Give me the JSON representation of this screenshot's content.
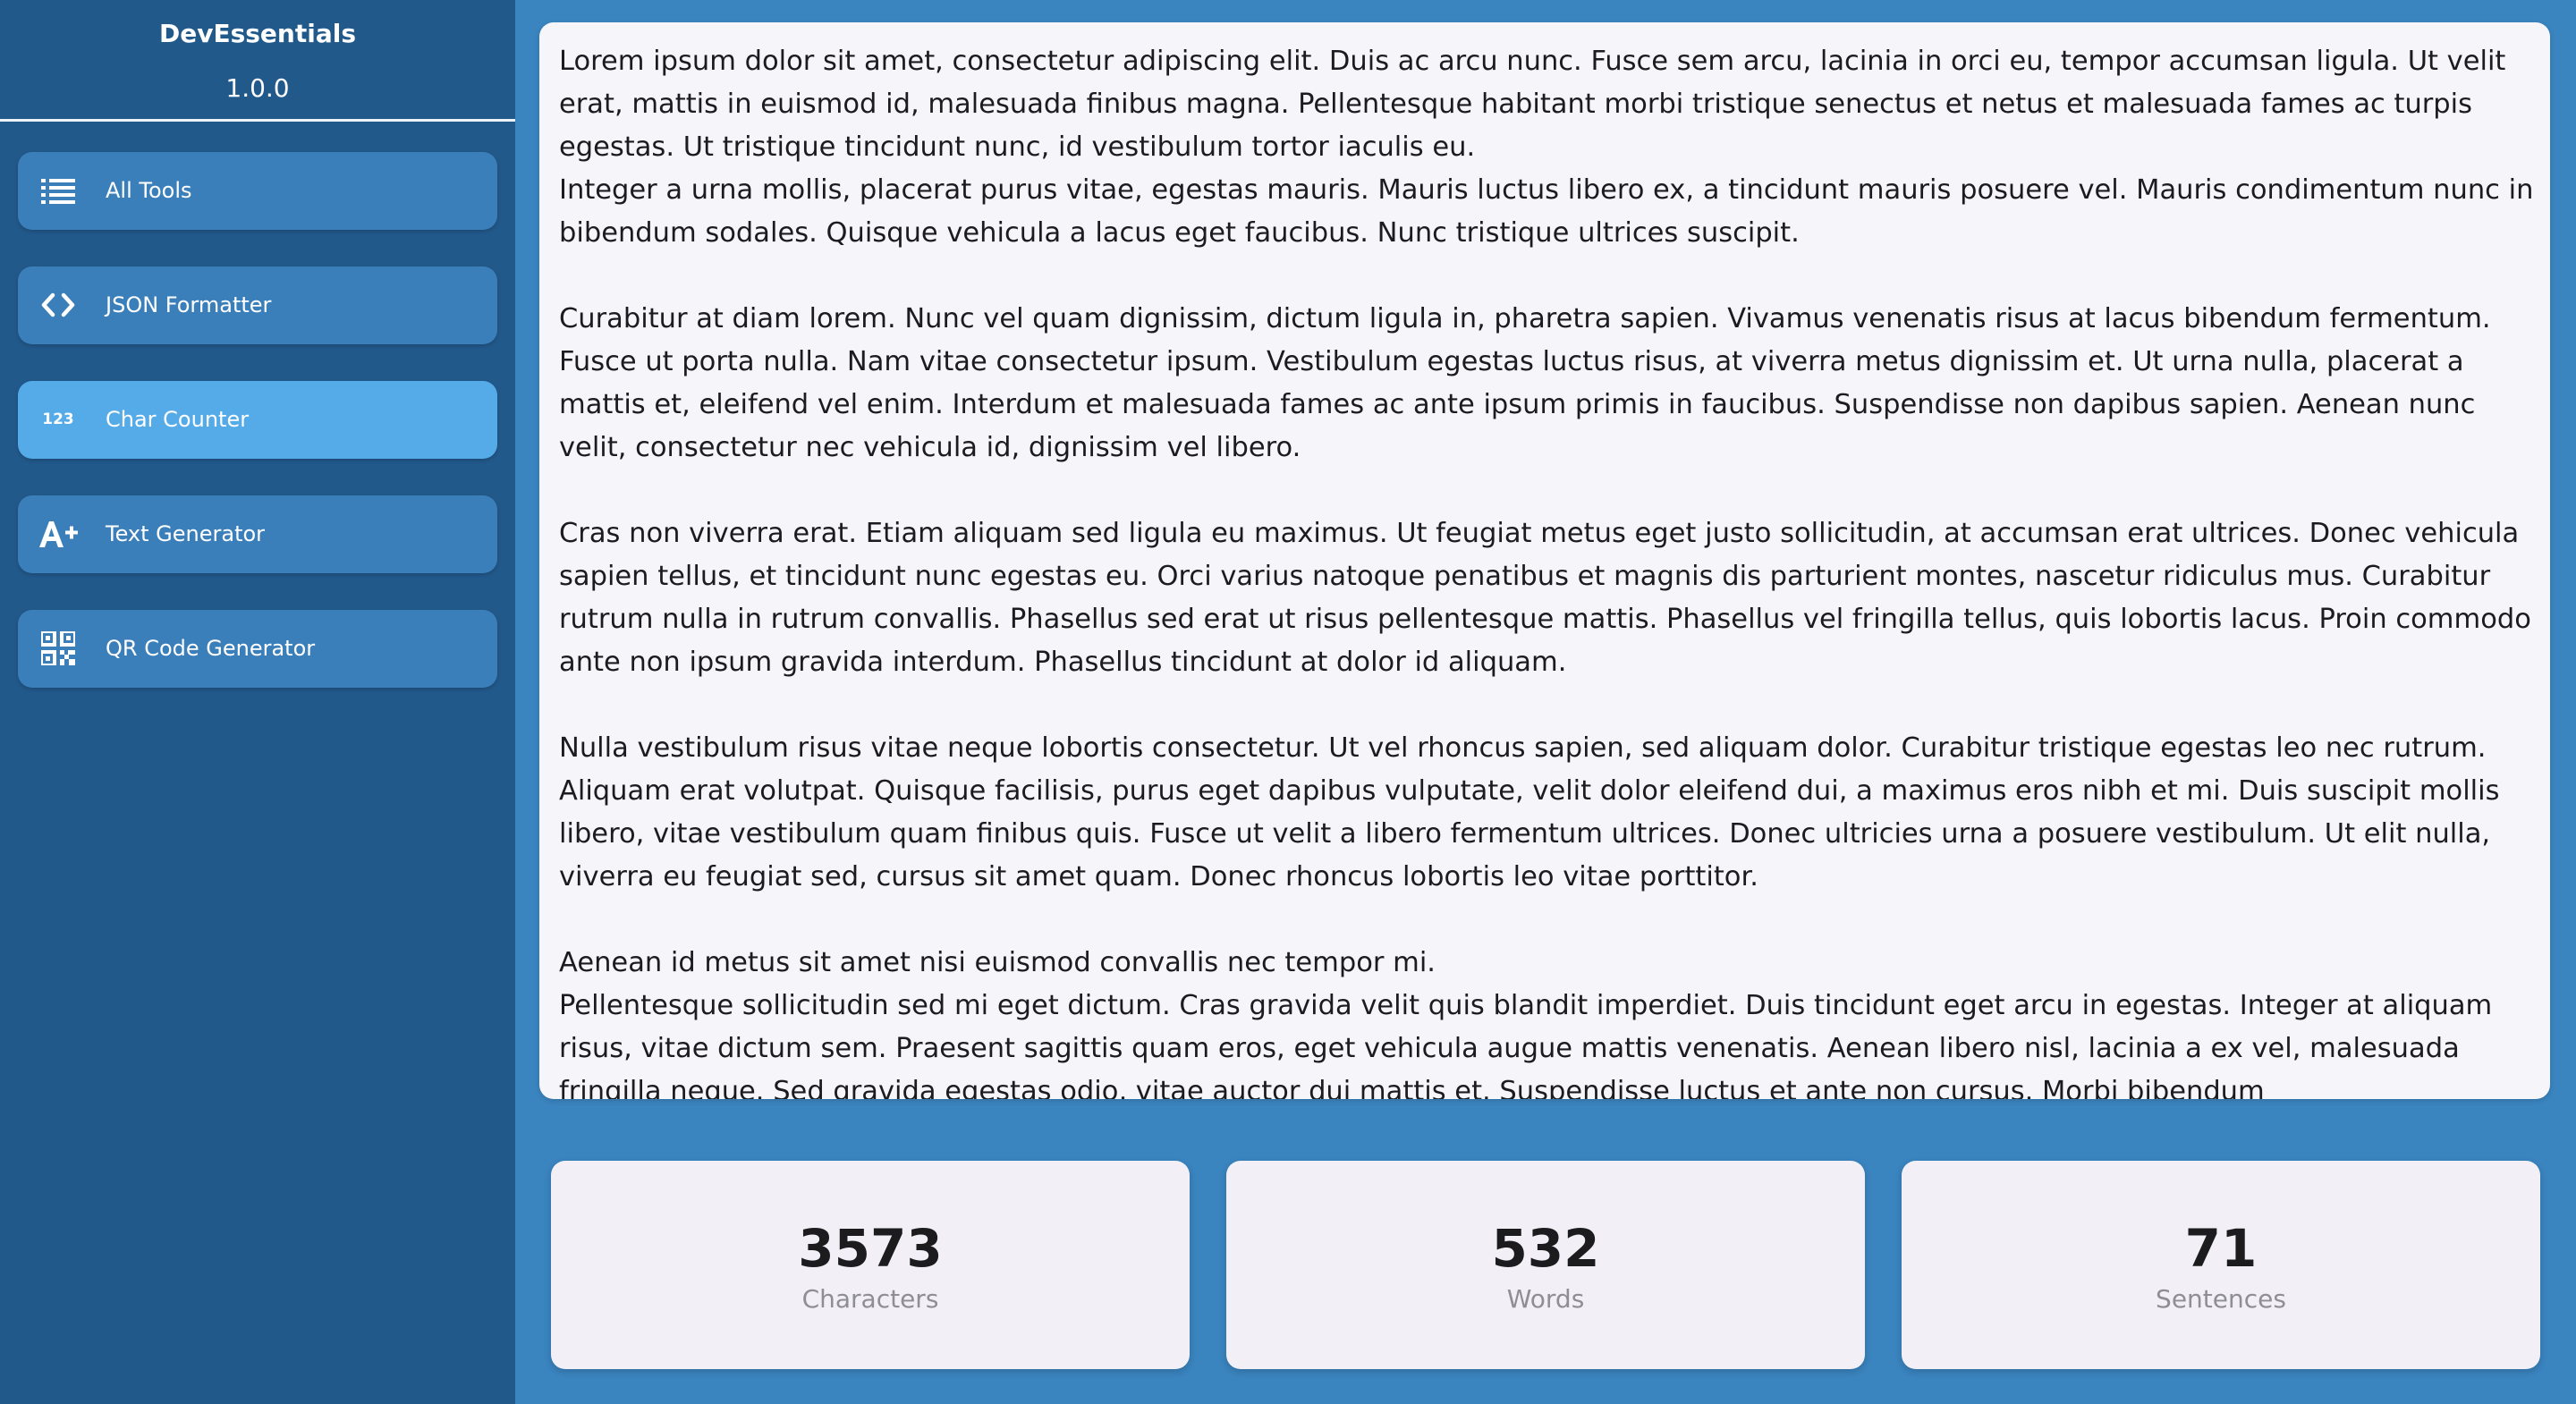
{
  "sidebar": {
    "app_name": "DevEssentials",
    "version": "1.0.0",
    "items": [
      {
        "label": "All Tools",
        "icon": "list-icon",
        "active": false
      },
      {
        "label": "JSON Formatter",
        "icon": "code-brackets-icon",
        "active": false
      },
      {
        "label": "Char Counter",
        "icon": "numbers-123-icon",
        "active": true
      },
      {
        "label": "Text Generator",
        "icon": "font-size-increase-icon",
        "active": false
      },
      {
        "label": "QR Code Generator",
        "icon": "qr-code-icon",
        "active": false
      }
    ]
  },
  "editor": {
    "text": "Lorem ipsum dolor sit amet, consectetur adipiscing elit. Duis ac arcu nunc. Fusce sem arcu, lacinia in orci eu, tempor accumsan ligula. Ut velit erat, mattis in euismod id, malesuada finibus magna. Pellentesque habitant morbi tristique senectus et netus et malesuada fames ac turpis egestas. Ut tristique tincidunt nunc, id vestibulum tortor iaculis eu.\nInteger a urna mollis, placerat purus vitae, egestas mauris. Mauris luctus libero ex, a tincidunt mauris posuere vel. Mauris condimentum nunc in bibendum sodales. Quisque vehicula a lacus eget faucibus. Nunc tristique ultrices suscipit.\n\nCurabitur at diam lorem. Nunc vel quam dignissim, dictum ligula in, pharetra sapien. Vivamus venenatis risus at lacus bibendum fermentum. Fusce ut porta nulla. Nam vitae consectetur ipsum. Vestibulum egestas luctus risus, at viverra metus dignissim et. Ut urna nulla, placerat a mattis et, eleifend vel enim. Interdum et malesuada fames ac ante ipsum primis in faucibus. Suspendisse non dapibus sapien. Aenean nunc velit, consectetur nec vehicula id, dignissim vel libero.\n\nCras non viverra erat. Etiam aliquam sed ligula eu maximus. Ut feugiat metus eget justo sollicitudin, at accumsan erat ultrices. Donec vehicula sapien tellus, et tincidunt nunc egestas eu. Orci varius natoque penatibus et magnis dis parturient montes, nascetur ridiculus mus. Curabitur rutrum nulla in rutrum convallis. Phasellus sed erat ut risus pellentesque mattis. Phasellus vel fringilla tellus, quis lobortis lacus. Proin commodo ante non ipsum gravida interdum. Phasellus tincidunt at dolor id aliquam.\n\nNulla vestibulum risus vitae neque lobortis consectetur. Ut vel rhoncus sapien, sed aliquam dolor. Curabitur tristique egestas leo nec rutrum. Aliquam erat volutpat. Quisque facilisis, purus eget dapibus vulputate, velit dolor eleifend dui, a maximus eros nibh et mi. Duis suscipit mollis libero, vitae vestibulum quam finibus quis. Fusce ut velit a libero fermentum ultrices. Donec ultricies urna a posuere vestibulum. Ut elit nulla, viverra eu feugiat sed, cursus sit amet quam. Donec rhoncus lobortis leo vitae porttitor.\n\nAenean id metus sit amet nisi euismod convallis nec tempor mi.\nPellentesque sollicitudin sed mi eget dictum. Cras gravida velit quis blandit imperdiet. Duis tincidunt eget arcu in egestas. Integer at aliquam risus, vitae dictum sem. Praesent sagittis quam eros, eget vehicula augue mattis venenatis. Aenean libero nisl, lacinia a ex vel, malesuada fringilla neque. Sed gravida egestas odio, vitae auctor dui mattis et. Suspendisse luctus et ante non cursus. Morbi bibendum"
  },
  "stats": {
    "characters": {
      "value": "3573",
      "label": "Characters"
    },
    "words": {
      "value": "532",
      "label": "Words"
    },
    "sentences": {
      "value": "71",
      "label": "Sentences"
    }
  },
  "colors": {
    "background": "#3a84bf",
    "sidebar": "#22598b",
    "nav_item": "#3b7fba",
    "nav_item_active": "#55aae8",
    "panel": "#f6f5fa",
    "stat_card": "#f2eff7"
  }
}
